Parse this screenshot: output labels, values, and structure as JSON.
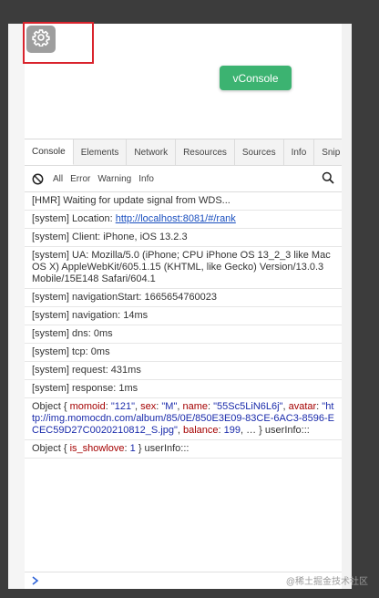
{
  "vconsole_button": {
    "label": "vConsole"
  },
  "tabs": [
    "Console",
    "Elements",
    "Network",
    "Resources",
    "Sources",
    "Info",
    "Snip"
  ],
  "filters": [
    "All",
    "Error",
    "Warning",
    "Info"
  ],
  "logs": [
    {
      "text": "[HMR] Waiting for update signal from WDS..."
    },
    {
      "prefix": "[system] Location: ",
      "link": "http://localhost:8081/#/rank"
    },
    {
      "text": "[system] Client: iPhone, iOS 13.2.3"
    },
    {
      "text": "[system] UA: Mozilla/5.0 (iPhone; CPU iPhone OS 13_2_3 like Mac OS X) AppleWebKit/605.1.15 (KHTML, like Gecko) Version/13.0.3 Mobile/15E148 Safari/604.1"
    },
    {
      "text": "[system] navigationStart: 1665654760023"
    },
    {
      "text": "[system] navigation: 14ms"
    },
    {
      "text": "[system] dns: 0ms"
    },
    {
      "text": "[system] tcp: 0ms"
    },
    {
      "text": "[system] request: 431ms"
    },
    {
      "text": "[system] response: 1ms"
    }
  ],
  "object_log1": {
    "open": "Object {",
    "momoid_key": "momoid",
    "momoid_val": "\"121\"",
    "sex_key": "sex",
    "sex_val": "\"M\"",
    "name_key": "name",
    "name_val": "\"55Sc5LiN6L6j\"",
    "avatar_key": "avatar",
    "avatar_val": "\"http://img.momocdn.com/album/85/0E/850E3E09-83CE-6AC3-8596-ECEC59D27C0020210812_S.jpg\"",
    "balance_key": "balance",
    "balance_val": "199",
    "close": ", … } userInfo:::"
  },
  "object_log2": {
    "open": "Object {",
    "key": "is_showlove",
    "val": "1",
    "close": "} userInfo:::"
  },
  "watermark": "@稀土掘金技术社区",
  "colors": {
    "vconsole_green": "#3cb371",
    "highlight_red": "#d9232c",
    "link_blue": "#1a4fbf"
  }
}
